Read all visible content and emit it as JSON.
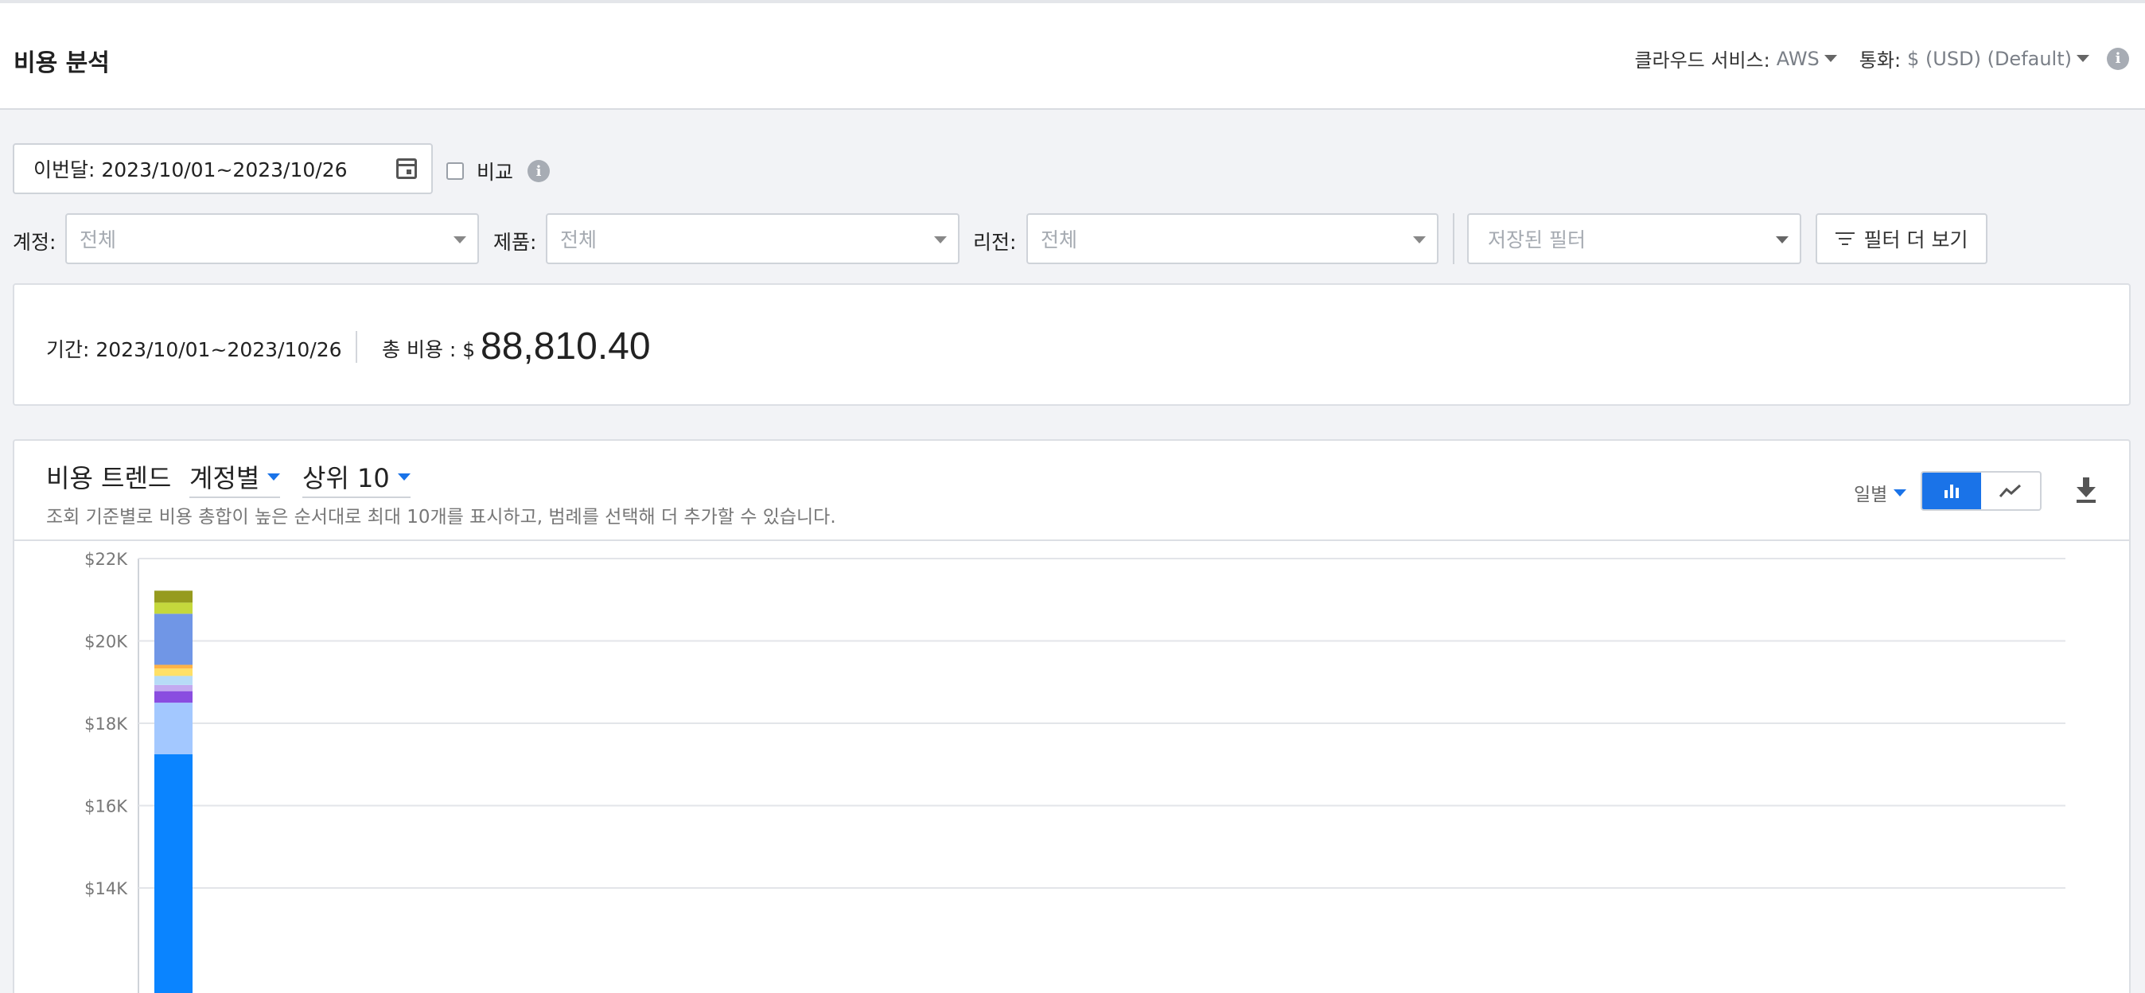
{
  "header": {
    "title": "비용 분석",
    "cloud_label": "클라우드 서비스:",
    "cloud_value": "AWS",
    "currency_label": "통화:",
    "currency_value": "$ (USD) (Default)"
  },
  "filters": {
    "date_range": "이번달: 2023/10/01~2023/10/26",
    "compare_label": "비교",
    "account_label": "계정:",
    "account_value": "전체",
    "product_label": "제품:",
    "product_value": "전체",
    "region_label": "리전:",
    "region_value": "전체",
    "saved_filter_placeholder": "저장된 필터",
    "more_filters_label": "필터 더 보기"
  },
  "summary": {
    "period": "기간: 2023/10/01~2023/10/26",
    "total_label": "총 비용 :",
    "currency_symbol": "$",
    "total_value": "88,810.40"
  },
  "trend": {
    "title": "비용 트렌드",
    "group_by": "계정별",
    "top_n": "상위 10",
    "description": "조회 기준별로 비용 총합이 높은 순서대로 최대 10개를 표시하고, 범례를 선택해 더 추가할 수 있습니다.",
    "granularity": "일별",
    "view_mode": "bar"
  },
  "chart_data": {
    "type": "bar",
    "stacked": true,
    "ylim": [
      13000,
      22000
    ],
    "yticks": [
      "$14K",
      "$16K",
      "$18K",
      "$20K",
      "$22K"
    ],
    "ytick_values": [
      14000,
      16000,
      18000,
      20000,
      22000
    ],
    "grid": true,
    "stack": [
      {
        "color": "#0a84ff",
        "from": 0,
        "to": 17250
      },
      {
        "color": "#a3c8ff",
        "from": 17250,
        "to": 18500
      },
      {
        "color": "#8a4de0",
        "from": 18500,
        "to": 18780
      },
      {
        "color": "#c3aaf0",
        "from": 18780,
        "to": 18930
      },
      {
        "color": "#b7dcf7",
        "from": 18930,
        "to": 19150
      },
      {
        "color": "#ffe066",
        "from": 19150,
        "to": 19330
      },
      {
        "color": "#ffb347",
        "from": 19330,
        "to": 19420
      },
      {
        "color": "#7096e6",
        "from": 19420,
        "to": 20660
      },
      {
        "color": "#c5d83c",
        "from": 20660,
        "to": 20930
      },
      {
        "color": "#969b1e",
        "from": 20930,
        "to": 21220
      }
    ]
  }
}
